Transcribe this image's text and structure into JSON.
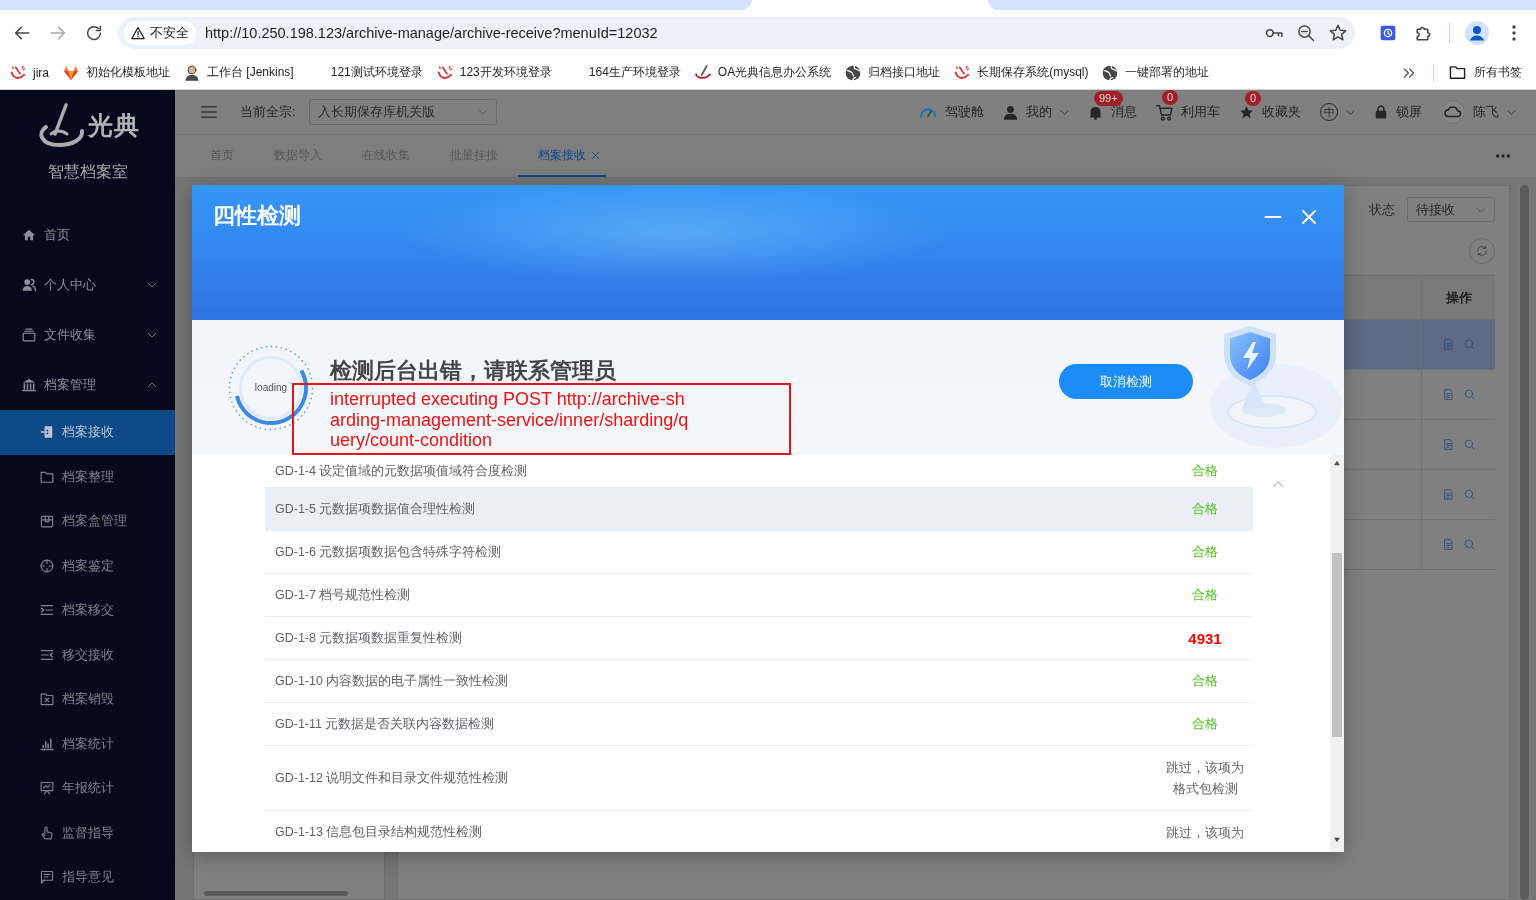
{
  "browser": {
    "security_label": "不安全",
    "url": "http://10.250.198.123/archive-manage/archive-receive?menuId=12032"
  },
  "bookmarks": [
    {
      "label": "jira"
    },
    {
      "label": "初始化模板地址"
    },
    {
      "label": "工作台 [Jenkins]"
    },
    {
      "label": "121测试环境登录"
    },
    {
      "label": "123开发环境登录"
    },
    {
      "label": "164生产环境登录"
    },
    {
      "label": "OA光典信息办公系统"
    },
    {
      "label": "归档接口地址"
    },
    {
      "label": "长期保存系统(mysql)"
    },
    {
      "label": "一键部署的地址"
    }
  ],
  "all_bookmarks": "所有书签",
  "sidebar": {
    "brand": "光典",
    "subtitle": "智慧档案室",
    "items": [
      {
        "label": "首页",
        "kind": "link",
        "selected": false
      },
      {
        "label": "个人中心",
        "kind": "group",
        "expanded": false,
        "selected": false
      },
      {
        "label": "文件收集",
        "kind": "group",
        "expanded": false,
        "selected": false
      },
      {
        "label": "档案管理",
        "kind": "group",
        "expanded": true,
        "selected": false,
        "children": [
          {
            "label": "档案接收",
            "selected": true
          },
          {
            "label": "档案整理",
            "selected": false
          },
          {
            "label": "档案盒管理",
            "selected": false
          },
          {
            "label": "档案鉴定",
            "selected": false
          },
          {
            "label": "档案移交",
            "selected": false
          },
          {
            "label": "移交接收",
            "selected": false
          },
          {
            "label": "档案销毁",
            "selected": false
          },
          {
            "label": "档案统计",
            "selected": false
          },
          {
            "label": "年报统计",
            "selected": false
          },
          {
            "label": "监督指导",
            "selected": false
          },
          {
            "label": "指导意见",
            "selected": false
          }
        ]
      }
    ]
  },
  "header": {
    "scope_label": "当前全宗:",
    "scope_value": "入长期保存库机关版",
    "actions": [
      {
        "kind": "link",
        "label": "驾驶舱"
      },
      {
        "kind": "menu",
        "label": "我的"
      },
      {
        "kind": "badge",
        "label": "消息",
        "badge": "99+"
      },
      {
        "kind": "badge",
        "label": "利用车",
        "badge": "0"
      },
      {
        "kind": "badge",
        "label": "收藏夹",
        "badge": "0"
      },
      {
        "kind": "language",
        "label": "中"
      },
      {
        "kind": "link",
        "label": "锁屏"
      },
      {
        "kind": "user",
        "label": "陈飞"
      }
    ]
  },
  "page_tabs": [
    {
      "label": "首页",
      "selected": false
    },
    {
      "label": "数据导入",
      "selected": false
    },
    {
      "label": "在线收集",
      "selected": false
    },
    {
      "label": "批量挂接",
      "selected": false
    },
    {
      "label": "档案接收",
      "selected": true
    }
  ],
  "workspace": {
    "status_label": "状态",
    "status_value": "待接收",
    "table": {
      "action_header": "操作",
      "rows": [
        {
          "selected": true
        },
        {
          "selected": false
        },
        {
          "selected": false
        },
        {
          "selected": false
        },
        {
          "selected": false
        }
      ]
    }
  },
  "modal": {
    "title": "四性检测",
    "loading_label": "loading",
    "heading": "检测后台出错，请联系管理员",
    "error": "interrupted executing POST http://archive-sharding-management-service/inner/sharding/query/count-condition",
    "cancel_button": "取消检测",
    "checks": [
      {
        "label": "GD-1-4 设定值域的元数据项值域符合度检测",
        "kind": "pass",
        "result": "合格",
        "highlighted": false
      },
      {
        "label": "GD-1-5 元数据项数据值合理性检测",
        "kind": "pass",
        "result": "合格",
        "highlighted": true
      },
      {
        "label": "GD-1-6 元数据项数据包含特殊字符检测",
        "kind": "pass",
        "result": "合格",
        "highlighted": false
      },
      {
        "label": "GD-1-7 档号规范性检测",
        "kind": "pass",
        "result": "合格",
        "highlighted": false
      },
      {
        "label": "GD-1-8 元数据项数据重复性检测",
        "kind": "fail",
        "result": "4931",
        "highlighted": false
      },
      {
        "label": "GD-1-10 内容数据的电子属性一致性检测",
        "kind": "pass",
        "result": "合格",
        "highlighted": false
      },
      {
        "label": "GD-1-11 元数据是否关联内容数据检测",
        "kind": "pass",
        "result": "合格",
        "highlighted": false
      },
      {
        "label": "GD-1-12 说明文件和目录文件规范性检测",
        "kind": "skip",
        "result": "跳过，该项为格式包检测",
        "highlighted": false
      },
      {
        "label": "GD-1-13 信息包目录结构规范性检测",
        "kind": "skip",
        "result": "跳过，该项为",
        "highlighted": false
      }
    ]
  }
}
